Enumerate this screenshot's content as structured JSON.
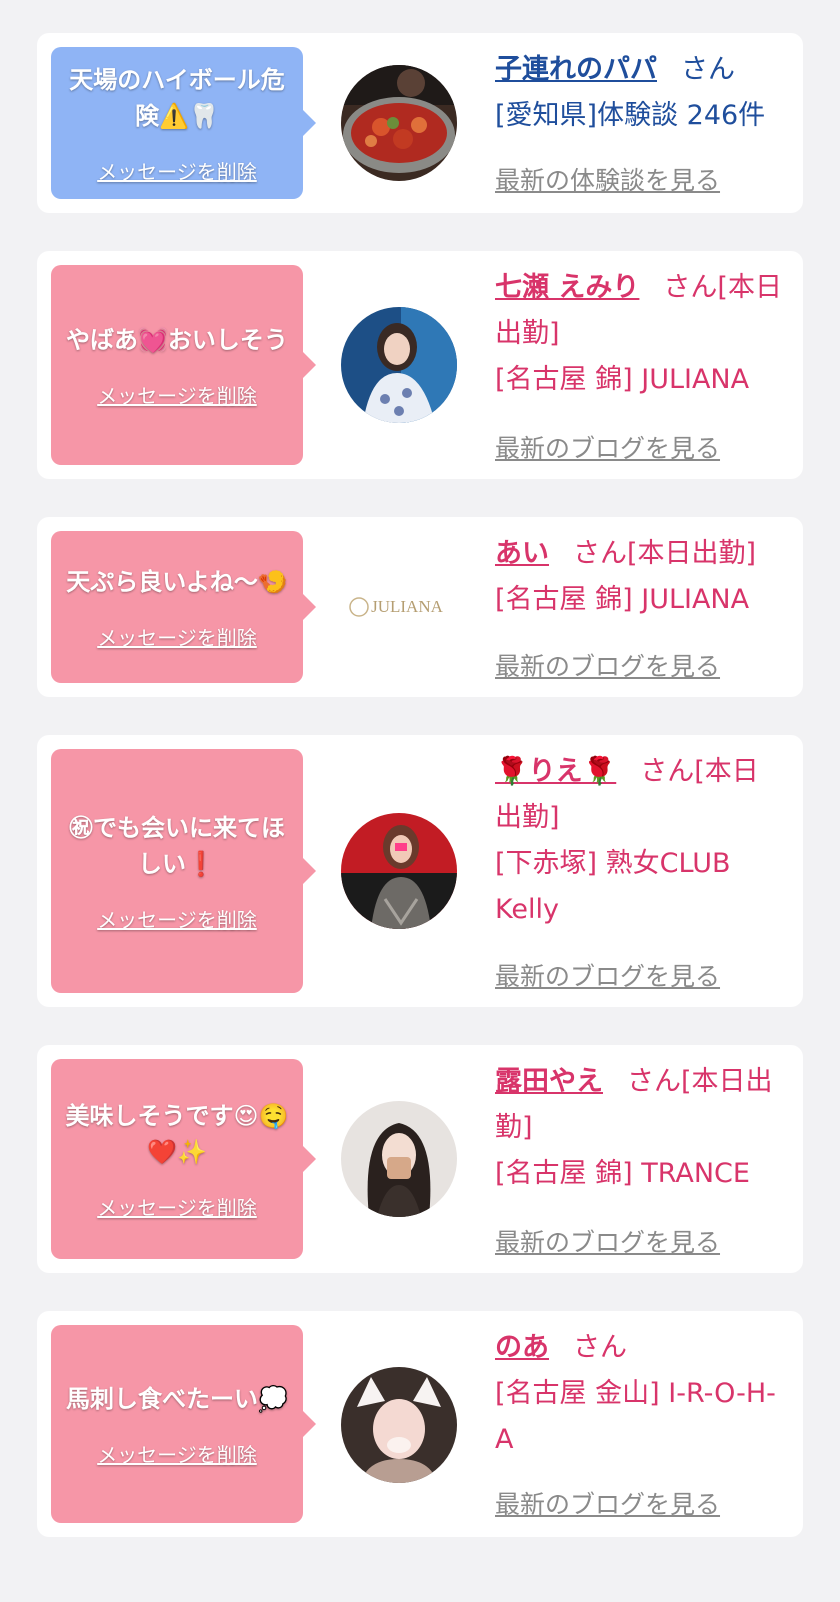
{
  "cards": [
    {
      "message": "天場のハイボール危険⚠️🦷",
      "delete_label": "メッセージを削除",
      "name": "子連れのパパ",
      "san": "さん",
      "meta": "[愛知県]体験談 246件",
      "view_label": "最新の体験談を見る",
      "theme": "blue",
      "avatar_icon": "seafood-dish-photo"
    },
    {
      "message": "やばあ💓おいしそう",
      "delete_label": "メッセージを削除",
      "name": "七瀬 えみり",
      "san": "さん[本日出勤]",
      "meta": "[名古屋 錦] JULIANA",
      "view_label": "最新のブログを見る",
      "theme": "pink",
      "avatar_icon": "woman-portrait-photo"
    },
    {
      "message": "天ぷら良いよね〜🍤",
      "delete_label": "メッセージを削除",
      "name": "あい",
      "san": "さん[本日出勤]",
      "meta": "[名古屋 錦] JULIANA",
      "view_label": "最新のブログを見る",
      "theme": "pink",
      "avatar_icon": "juliana-logo",
      "logo_text": "JULIANA"
    },
    {
      "message": "㊗でも会いに来てほしい❗",
      "delete_label": "メッセージを削除",
      "name": "🌹りえ🌹",
      "san": "さん[本日出勤]",
      "meta": "[下赤塚] 熟女CLUB Kelly",
      "view_label": "最新のブログを見る",
      "theme": "pink",
      "avatar_icon": "woman-red-background-photo"
    },
    {
      "message": "美味しそうです😍🤤❤️✨",
      "delete_label": "メッセージを削除",
      "name": "露田やえ",
      "san": "さん[本日出勤]",
      "meta": "[名古屋 錦] TRANCE",
      "view_label": "最新のブログを見る",
      "theme": "pink",
      "avatar_icon": "woman-mask-photo"
    },
    {
      "message": "馬刺し食べたーい💭",
      "delete_label": "メッセージを削除",
      "name": "のあ",
      "san": "さん",
      "meta": "[名古屋 金山] I-R-O-H-A",
      "view_label": "最新のブログを見る",
      "theme": "pink",
      "avatar_icon": "woman-cat-ears-photo"
    }
  ],
  "colors": {
    "blue_bubble": "#8fb4f5",
    "pink_bubble": "#f696a7",
    "blue_text": "#1f4e9c",
    "pink_text": "#d8346a",
    "link_gray": "#8a8a8a",
    "background": "#f2f2f4"
  }
}
